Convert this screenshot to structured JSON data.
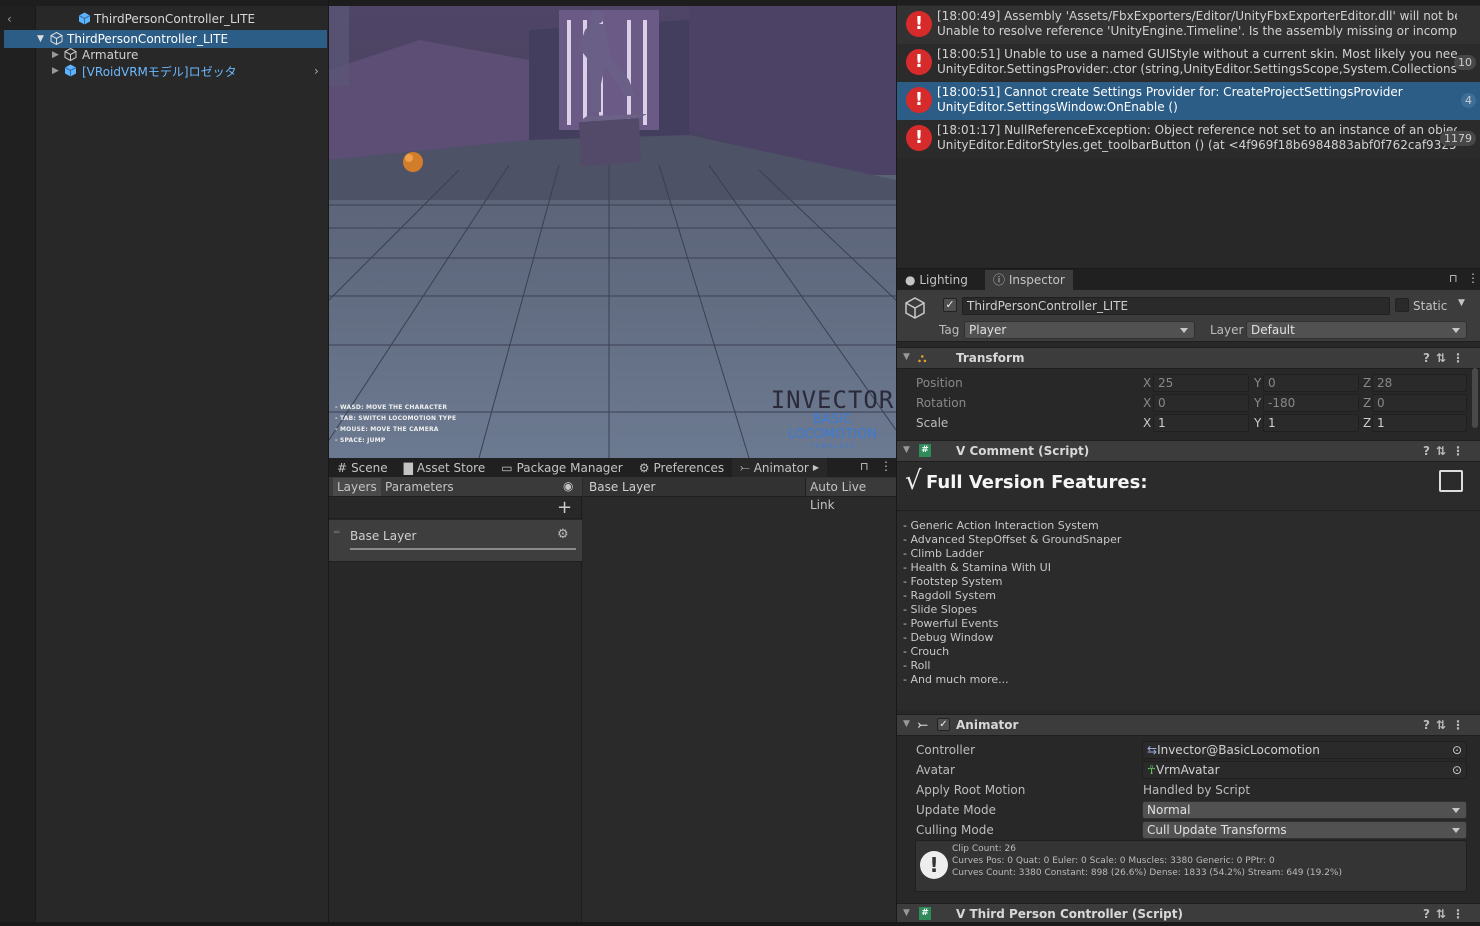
{
  "hierarchy": {
    "scene_title": "ThirdPersonController_LITE",
    "items": [
      {
        "label": "ThirdPersonController_LITE"
      },
      {
        "label": "Armature"
      },
      {
        "label": "[VRoidVRMモデル]ロゼッタ"
      }
    ]
  },
  "scene_view": {
    "logo_main": "INVECTOR",
    "logo_sub": "BASIC LOCOMOTION",
    "logo_small": "T E M P L A T E",
    "controls": [
      "- WASD: MOVE THE CHARACTER",
      "- TAB: SWITCH LOCOMOTION TYPE",
      "- MOUSE: MOVE THE CAMERA",
      "- SPACE: JUMP"
    ]
  },
  "bottom_tabs": [
    "Scene",
    "Asset Store",
    "Package Manager",
    "Preferences",
    "Animator"
  ],
  "animator": {
    "left_tabs": [
      "Layers",
      "Parameters"
    ],
    "breadcrumb": "Base Layer",
    "auto_live_link": "Auto Live Link",
    "layer_item": "Base Layer"
  },
  "console": {
    "logs": [
      {
        "line1": "[18:00:49] Assembly 'Assets/FbxExporters/Editor/UnityFbxExporterEditor.dll' will not be loaded due",
        "line2": "Unable to resolve reference 'UnityEngine.Timeline'. Is the assembly missing or incompatible with t",
        "count": ""
      },
      {
        "line1": "[18:00:51] Unable to use a named GUIStyle without a current skin. Most likely you need to move",
        "line2": "UnityEditor.SettingsProvider:.ctor (string,UnityEditor.SettingsScope,System.Collections.Generic",
        "count": "10"
      },
      {
        "line1": "[18:00:51] Cannot create Settings Provider for: CreateProjectSettingsProvider",
        "line2": "UnityEditor.SettingsWindow:OnEnable ()",
        "count": "4"
      },
      {
        "line1": "[18:01:17] NullReferenceException: Object reference not set to an instance of an object",
        "line2": "UnityEditor.EditorStyles.get_toolbarButton () (at <4f969f18b6984883abf0f762caf9325d>:0)",
        "count": "1179"
      }
    ]
  },
  "inspector": {
    "tabs": [
      "Lighting",
      "Inspector"
    ],
    "object_name": "ThirdPersonController_LITE",
    "static_label": "Static",
    "tag_label": "Tag",
    "tag_value": "Player",
    "layer_label": "Layer",
    "layer_value": "Default",
    "transform": {
      "title": "Transform",
      "rows": [
        {
          "label": "Position",
          "x": "25",
          "y": "0",
          "z": "28"
        },
        {
          "label": "Rotation",
          "x": "0",
          "y": "-180",
          "z": "0"
        },
        {
          "label": "Scale",
          "x": "1",
          "y": "1",
          "z": "1"
        }
      ],
      "axes": [
        "X",
        "Y",
        "Z"
      ]
    },
    "comment": {
      "title": "V Comment (Script)",
      "heading": "Full Version Features:",
      "features": [
        "- Generic Action Interaction System",
        "- Advanced StepOffset & GroundSnaper",
        "- Climb Ladder",
        "- Health & Stamina With UI",
        "- Footstep System",
        "- Ragdoll System",
        "- Slide Slopes",
        "- Powerful Events",
        "- Debug Window",
        "- Crouch",
        "- Roll",
        "- And much more..."
      ]
    },
    "animator_comp": {
      "title": "Animator",
      "controller_label": "Controller",
      "controller_value": "Invector@BasicLocomotion",
      "avatar_label": "Avatar",
      "avatar_value": "VrmAvatar",
      "root_motion_label": "Apply Root Motion",
      "root_motion_value": "Handled by Script",
      "update_mode_label": "Update Mode",
      "update_mode_value": "Normal",
      "culling_label": "Culling Mode",
      "culling_value": "Cull Update Transforms",
      "info_lines": [
        "Clip Count: 26",
        "Curves Pos: 0 Quat: 0 Euler: 0 Scale: 0 Muscles: 3380 Generic: 0 PPtr: 0",
        "Curves Count: 3380 Constant: 898 (26.6%) Dense: 1833 (54.2%) Stream: 649 (19.2%)"
      ]
    },
    "third_person": {
      "title": "V Third Person Controller (Script)"
    }
  },
  "colors": {
    "accent": "#2c5d87",
    "error": "#d72a2a",
    "prefab_blue": "#5eb3ff"
  }
}
